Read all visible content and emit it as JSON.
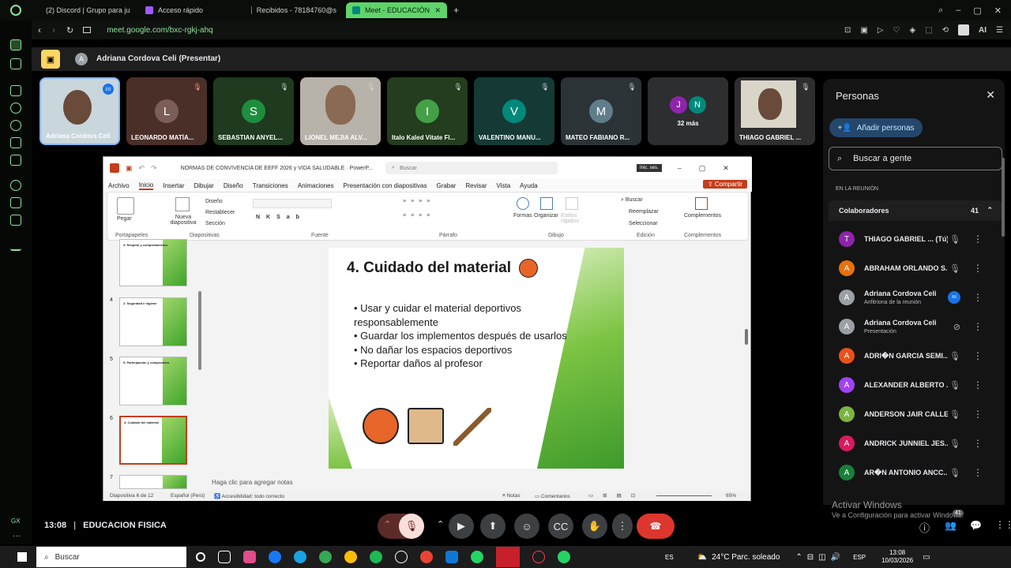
{
  "browser": {
    "tabs": [
      {
        "label": "(2) Discord | Grupo para ju",
        "color": "#5865f2"
      },
      {
        "label": "Acceso rápido",
        "color": "#a259ff"
      },
      {
        "label": "Recibidos - 78184760@s",
        "color": "#ea4335"
      },
      {
        "label": "Meet - EDUCACIÓN",
        "color": "#00897b"
      }
    ],
    "url": "meet.google.com/bxc-rgkj-ahq",
    "ai_label": "AI"
  },
  "meet": {
    "presenter_banner": "Adriana Cordova Celi (Presentar)",
    "presenter_initial": "A",
    "tiles": [
      {
        "name": "Adriana Cordova Celi",
        "initial": "",
        "color": "#9aa0a6"
      },
      {
        "name": "LEONARDO MATÍA...",
        "initial": "L",
        "color": "#7b5e57"
      },
      {
        "name": "SEBASTIAN ANYEL...",
        "initial": "S",
        "color": "#1e8e3e"
      },
      {
        "name": "LIONEL MEJIA ALV...",
        "initial": "",
        "color": "#8d8d8d"
      },
      {
        "name": "Italo Kaled Vitate Fl...",
        "initial": "I",
        "color": "#43a047"
      },
      {
        "name": "VALENTINO MANU...",
        "initial": "V",
        "color": "#00897b"
      },
      {
        "name": "MATEO FABIANO R...",
        "initial": "M",
        "color": "#607d8b"
      },
      {
        "name": "32 más",
        "initial": "",
        "color": "#3c4043"
      },
      {
        "name": "THIAGO GABRIEL ...",
        "initial": "",
        "color": "#3c4043"
      }
    ],
    "more_initials": [
      "J",
      "N"
    ],
    "meeting_time": "13:08",
    "meeting_name": "EDUCACION FISICA"
  },
  "ppt": {
    "file_title": "NORMAS DE CONVIVENCIA DE EEFF 2026 y VIDA SALUDABLE · PowerP...",
    "search": "Buscar",
    "signin": "Inic. ses.",
    "share": "Compartir",
    "menu": [
      "Archivo",
      "Inicio",
      "Insertar",
      "Dibujar",
      "Diseño",
      "Transiciones",
      "Animaciones",
      "Presentación con diapositivas",
      "Grabar",
      "Revisar",
      "Vista",
      "Ayuda"
    ],
    "ribbon_groups": [
      "Portapapeles",
      "Diapositivas",
      "Fuente",
      "Párrafo",
      "Dibujo",
      "Edición",
      "Complementos"
    ],
    "ribbon_items": {
      "paste": "Pegar",
      "new_slide": "Nueva diapositiva",
      "layout": "Diseño",
      "reset": "Restablecer",
      "section": "Sección",
      "shapes": "Formas",
      "arrange": "Organizar",
      "styles": "Estilos rápidos",
      "find": "Buscar",
      "replace": "Reemplazar",
      "select": "Seleccionar",
      "addins": "Complementos"
    },
    "thumbs": [
      {
        "num": "",
        "title": "3. Respeto y comportamiento"
      },
      {
        "num": "4",
        "title": "2. Seguridad e higiene"
      },
      {
        "num": "5",
        "title": "5. Participación y compromiso"
      },
      {
        "num": "6",
        "title": "4. Cuidado del material"
      },
      {
        "num": "7",
        "title": ""
      }
    ],
    "slide": {
      "title": "4. Cuidado del material",
      "bullets": [
        "Usar y cuidar el material deportivos responsablemente",
        "Guardar los implementos después de usarlos",
        "No dañar los espacios deportivos",
        "Reportar daños al profesor"
      ]
    },
    "notes": "Haga clic para agregar notas",
    "status": {
      "slide": "Diapositiva 6 de 12",
      "lang": "Español (Perú)",
      "access": "Accesibilidad: todo correcto",
      "notes": "Notas",
      "comments": "Comentarios",
      "zoom": "65%"
    }
  },
  "people": {
    "title": "Personas",
    "add": "Añadir personas",
    "search": "Buscar a gente",
    "in_meeting": "EN LA REUNIÓN",
    "collab": "Colaboradores",
    "count": "41",
    "list": [
      {
        "name": "THIAGO GABRIEL ...",
        "suffix": "(Tú)",
        "sub": "",
        "initial": "T",
        "color": "#8e24aa"
      },
      {
        "name": "ABRAHAM ORLANDO S...",
        "suffix": "",
        "sub": "",
        "initial": "A",
        "color": "#e8710a"
      },
      {
        "name": "Adriana Cordova Celi",
        "suffix": "",
        "sub": "Anfitriona de la reunión",
        "initial": "A",
        "color": "#9aa0a6"
      },
      {
        "name": "Adriana Cordova Celi",
        "suffix": "",
        "sub": "Presentación",
        "initial": "A",
        "color": "#9aa0a6"
      },
      {
        "name": "ADRI�N GARCIA SEMI...",
        "suffix": "",
        "sub": "",
        "initial": "A",
        "color": "#e8511a"
      },
      {
        "name": "ALEXANDER ALBERTO ...",
        "suffix": "",
        "sub": "",
        "initial": "A",
        "color": "#a142f4"
      },
      {
        "name": "ANDERSON JAIR CALLE...",
        "suffix": "",
        "sub": "",
        "initial": "A",
        "color": "#7cb342"
      },
      {
        "name": "ANDRICK JUNNIEL JES...",
        "suffix": "",
        "sub": "",
        "initial": "A",
        "color": "#d81b60"
      },
      {
        "name": "AR�N ANTONIO ANCC...",
        "suffix": "",
        "sub": "",
        "initial": "A",
        "color": "#188038"
      }
    ],
    "watermark1": "Activar Windows",
    "watermark2": "Ve a Configuración para activar Windows.",
    "badge": "41"
  },
  "taskbar": {
    "search": "Buscar",
    "lang": "ES",
    "weather": "24°C  Parc. soleado",
    "kbd": "ESP",
    "time": "13:08",
    "date": "10/03/2026"
  }
}
